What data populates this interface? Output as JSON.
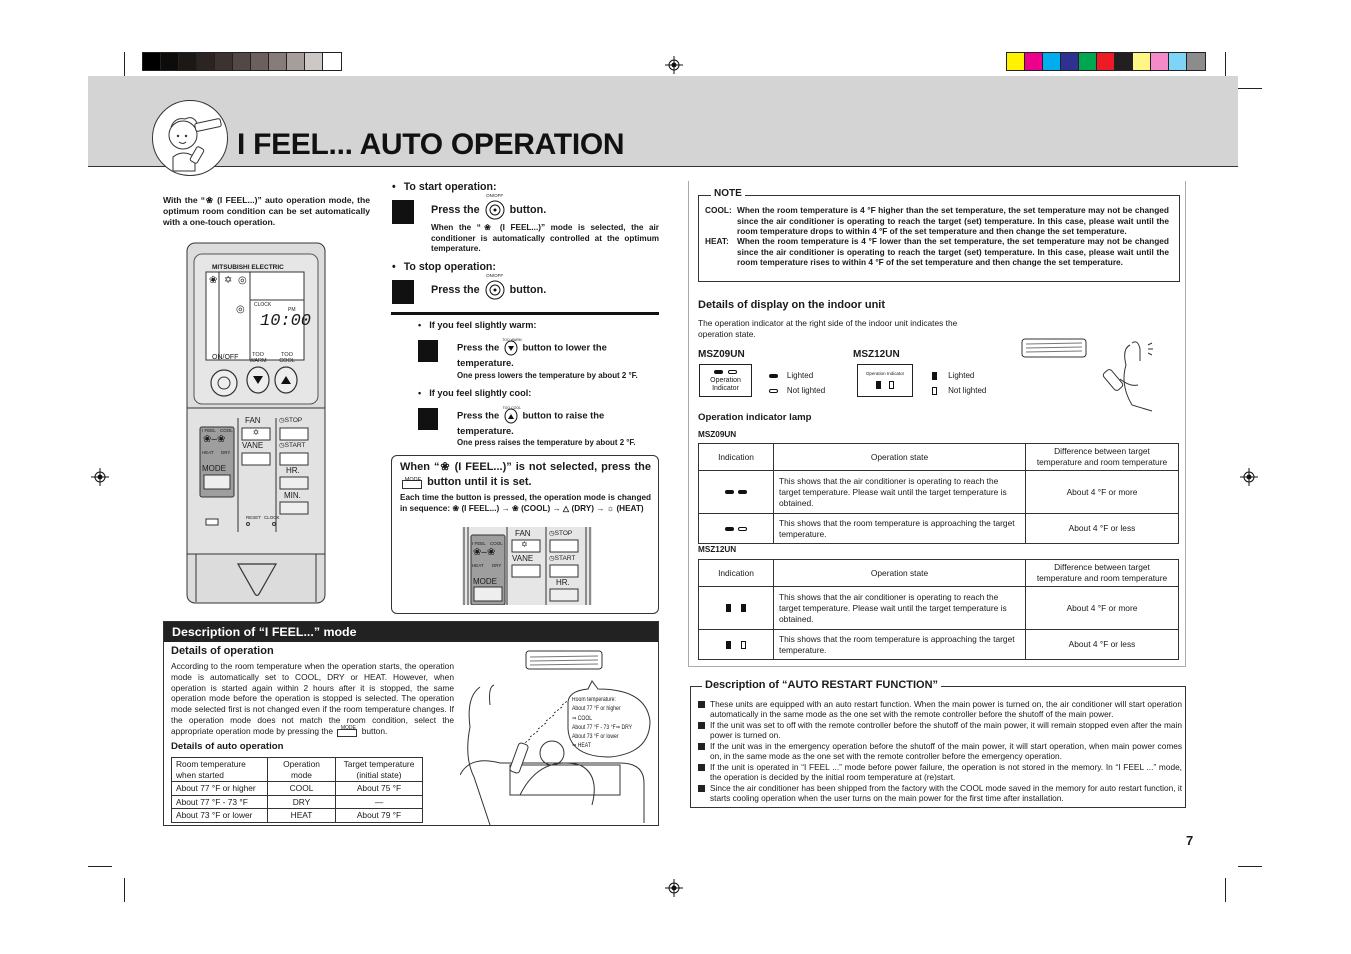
{
  "page": {
    "title": "I FEEL... AUTO OPERATION",
    "page_number": "7",
    "gray_swatches": [
      "#000000",
      "#0e0c0b",
      "#1c1816",
      "#2b2422",
      "#3c3330",
      "#524845",
      "#6b605d",
      "#867c79",
      "#a69e9b",
      "#cdc7c5",
      "#ffffff"
    ],
    "color_swatches": [
      "#fff200",
      "#ec008c",
      "#00aeef",
      "#2e3192",
      "#00a651",
      "#ed1c24",
      "#231f20",
      "#fff685",
      "#f58ac8",
      "#7dd4f7",
      "#8c8c8c"
    ]
  },
  "intro": {
    "text_pre": "With the “",
    "text_post": " (I FEEL...)” auto operation mode, the optimum room condition can be set automatically with a one-touch operation."
  },
  "remote": {
    "brand": "MITSUBISHI ELECTRIC",
    "clock_label": "CLOCK",
    "pm_label": "PM",
    "time": "10:00",
    "onoff_label": "ON/OFF",
    "too_warm_label": "TOO WARM",
    "too_cool_label": "TOO COOL",
    "fan_label": "FAN",
    "vane_label": "VANE",
    "stop_label": "STOP",
    "start_label": "START",
    "hr_label": "HR.",
    "min_label": "MIN.",
    "mode_label": "MODE",
    "ifeel_label": "I FEEL",
    "cool_label": "COOL",
    "heat_label": "HEAT",
    "dry_label": "DRY",
    "reset_label": "RESET",
    "clock_btn_label": "CLOCK"
  },
  "start": {
    "heading": "To start operation:",
    "press_pre": "Press the",
    "press_post": "button.",
    "button_caption": "ON/OFF",
    "note": "When the “❀ (I FEEL...)” mode is selected, the air conditioner is automatically controlled at the optimum temperature."
  },
  "stop": {
    "heading": "To stop operation:",
    "press_pre": "Press the",
    "press_post": "button.",
    "button_caption": "ON/OFF"
  },
  "warm": {
    "heading": "If you feel slightly warm:",
    "press_pre": "Press the",
    "press_post": "button to lower the temperature.",
    "button_caption": "TOO WARM",
    "note": "One press lowers the temperature by about 2 °F."
  },
  "cool": {
    "heading": "If you feel slightly cool:",
    "press_pre": "Press the",
    "press_post": "button to raise the temperature.",
    "button_caption": "TOO COOL",
    "note": "One press raises the temperature by about 2 °F."
  },
  "mode_box": {
    "heading_pre": "When “❀ (I FEEL...)” is not selected, press the",
    "heading_post": "button until it is set.",
    "mode_caption": "MODE",
    "sequence": "Each time the button is pressed, the operation mode is changed in sequence: ❀ (I FEEL...) → ❀ (COOL) → △ (DRY) → ☼ (HEAT)"
  },
  "description": {
    "header": "Description of “I FEEL...” mode",
    "details_op_title": "Details of operation",
    "details_op_text": "According to the room temperature when the operation starts, the operation mode is automatically set to COOL, DRY or HEAT. However, when operation is started again within 2 hours after it is stopped, the same operation mode before the operation is stopped is selected. The operation mode selected first is not changed even if the room temperature changes. If the operation mode does not match the room condition, select the appropriate operation mode by pressing the",
    "details_op_text_end": "button.",
    "mode_caption": "MODE",
    "details_auto_title": "Details of auto operation",
    "table": {
      "headers": [
        "Room temperature when started",
        "Operation mode",
        "Target temperature (initial state)"
      ],
      "rows": [
        [
          "About 77 °F or higher",
          "COOL",
          "About 75 °F"
        ],
        [
          "About 77 °F - 73 °F",
          "DRY",
          "—"
        ],
        [
          "About 73 °F or lower",
          "HEAT",
          "About 79 °F"
        ]
      ]
    },
    "bubble": [
      "Room temperature:",
      "About 77 °F or higher",
      "⇒ COOL",
      "About 77 °F - 73 °F⇒ DRY",
      "About 73 °F or lower",
      "⇒ HEAT"
    ]
  },
  "note": {
    "label": "NOTE",
    "cool_key": "COOL:",
    "cool_text": "When the room temperature is 4 °F higher than the set temperature, the set temperature may not be changed since the air conditioner is operating to reach the target (set) temperature. In this case, please wait until the room temperature drops to within 4 °F of the set temperature and then change the set temperature.",
    "heat_key": "HEAT:",
    "heat_text": "When the room temperature is 4 °F lower than the set temperature, the set temperature may not be changed since the air conditioner is operating to reach the target (set) temperature. In this case, please wait until the room temperature rises to within 4 °F of the set temperature and then change the set temperature."
  },
  "display": {
    "title": "Details of display on the indoor unit",
    "text": "The operation indicator at the right side of the indoor unit indicates the operation state.",
    "msz09_label": "MSZ09UN",
    "msz12_label": "MSZ12UN",
    "operation_indicator": "Operation Indicator",
    "lighted": "Lighted",
    "not_lighted": "Not lighted"
  },
  "lamp": {
    "title": "Operation indicator lamp",
    "msz09_label": "MSZ09UN",
    "msz12_label": "MSZ12UN",
    "headers": [
      "Indication",
      "Operation state",
      "Difference between target temperature and room temperature"
    ],
    "rows": [
      [
        "This shows that the air conditioner is operating to reach the target temperature. Please wait until the target temperature is obtained.",
        "About 4 °F or more"
      ],
      [
        "This shows that the room temperature is approaching the target temperature.",
        "About 4 °F or less"
      ]
    ]
  },
  "restart": {
    "title": "Description of “AUTO RESTART FUNCTION”",
    "items": [
      "These units are equipped with an auto restart function. When the main power is turned on, the air conditioner will start operation automatically in the same mode as the one set with the remote controller before the shutoff of the main power.",
      "If the unit was set to off with the remote controller before the shutoff of the main power, it will remain stopped even after the main power is turned on.",
      "If the unit was in the emergency operation before the shutoff of the main power, it will start operation, when main power comes on, in the same mode as the one set with the remote controller before the emergency operation.",
      "If the unit is operated in “I FEEL ...” mode before power failure, the operation is not stored in the memory. In “I FEEL ...” mode, the operation is decided by the initial room temperature at (re)start.",
      "Since the air conditioner has been shipped from the factory with the COOL mode saved in the memory for auto restart function, it starts cooling operation when the user turns on the main power for the first time after installation."
    ]
  }
}
